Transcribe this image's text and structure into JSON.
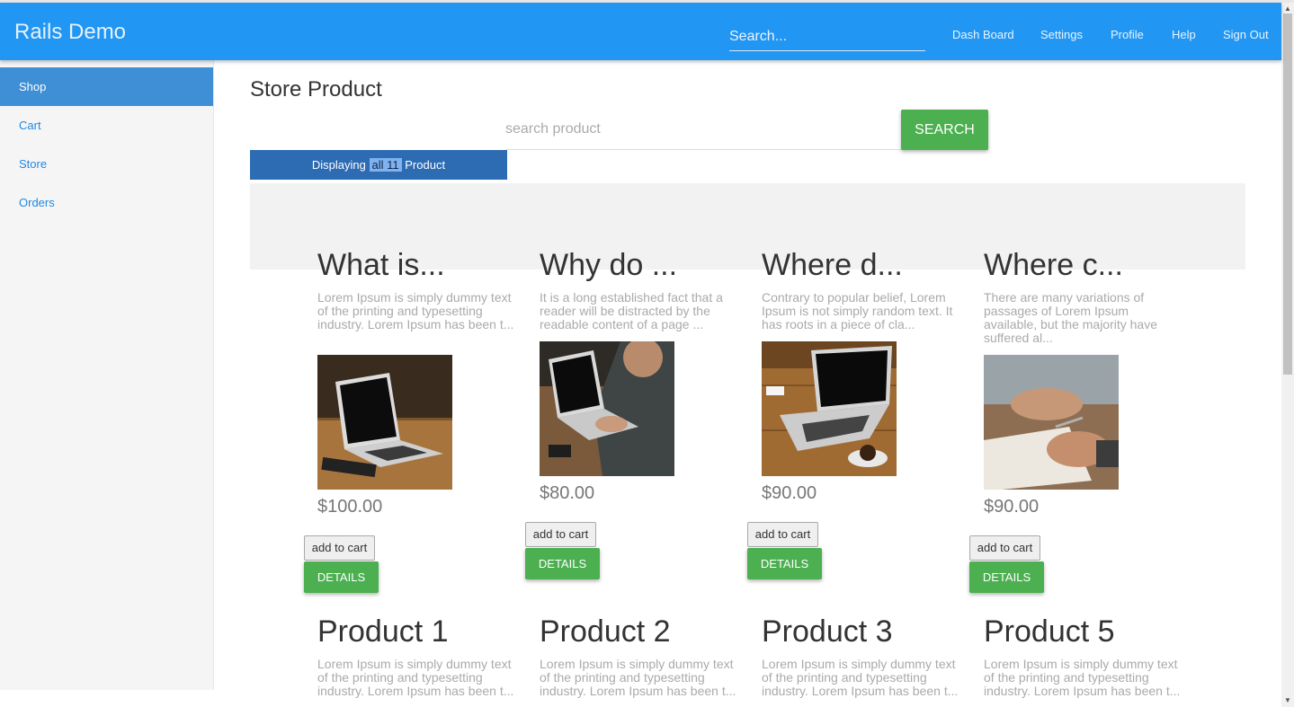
{
  "header": {
    "brand": "Rails Demo",
    "search_placeholder": "Search...",
    "nav": [
      "Dash Board",
      "Settings",
      "Profile",
      "Help",
      "Sign Out"
    ],
    "color": "#2196f3"
  },
  "sidebar": {
    "items": [
      {
        "label": "Shop",
        "active": true
      },
      {
        "label": "Cart",
        "active": false
      },
      {
        "label": "Store",
        "active": false
      },
      {
        "label": "Orders",
        "active": false
      }
    ]
  },
  "main": {
    "title": "Store Product",
    "search_placeholder": "search product",
    "search_button": "SEARCH",
    "display": {
      "prefix": "Displaying",
      "highlight": "all 11",
      "suffix": "Product"
    },
    "products": [
      {
        "title": "What is...",
        "desc": "Lorem Ipsum is simply dummy text of the printing and typesetting industry. Lorem Ipsum has been t...",
        "price": "$100.00",
        "cart": "add to cart",
        "details": "DETAILS"
      },
      {
        "title": "Why do ...",
        "desc": "It is a long established fact that a reader will be distracted by the readable content of a page ...",
        "price": "$80.00",
        "cart": "add to cart",
        "details": "DETAILS"
      },
      {
        "title": "Where d...",
        "desc": "Contrary to popular belief, Lorem Ipsum is not simply random text. It has roots in a piece of cla...",
        "price": "$90.00",
        "cart": "add to cart",
        "details": "DETAILS"
      },
      {
        "title": "Where c...",
        "desc": "There are many variations of passages of Lorem Ipsum available, but the majority have suffered al...",
        "price": "$90.00",
        "cart": "add to cart",
        "details": "DETAILS"
      },
      {
        "title": "Product 1",
        "desc": "Lorem Ipsum is simply dummy text of the printing and typesetting industry. Lorem Ipsum has been t..."
      },
      {
        "title": "Product 2",
        "desc": "Lorem Ipsum is simply dummy text of the printing and typesetting industry. Lorem Ipsum has been t..."
      },
      {
        "title": "Product 3",
        "desc": "Lorem Ipsum is simply dummy text of the printing and typesetting industry. Lorem Ipsum has been t..."
      },
      {
        "title": "Product 5",
        "desc": "Lorem Ipsum is simply dummy text of the printing and typesetting industry. Lorem Ipsum has been t..."
      }
    ]
  }
}
